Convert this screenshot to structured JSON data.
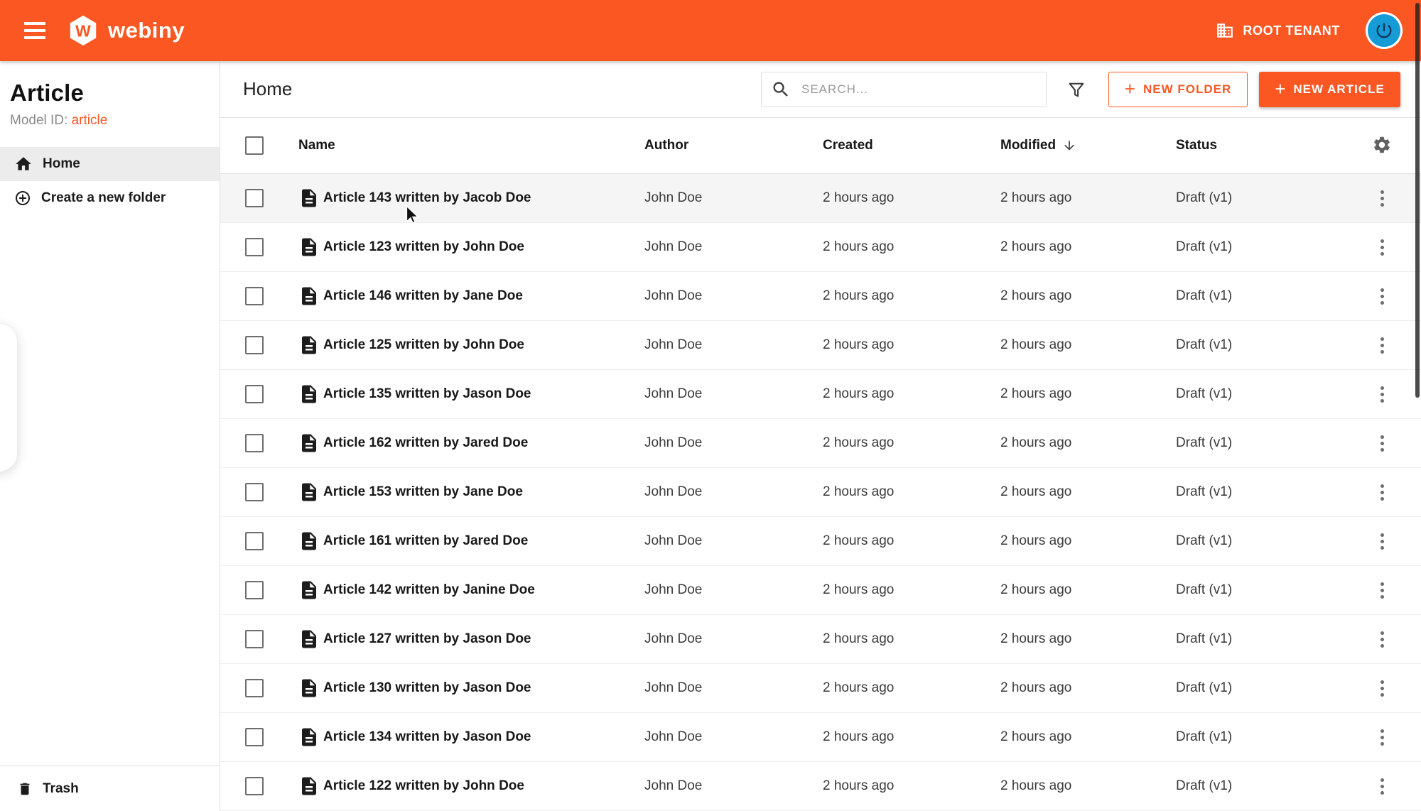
{
  "colors": {
    "accent": "#fa5723",
    "avatar": "#169bd7"
  },
  "topbar": {
    "brand_text": "webiny",
    "logo_letter": "W",
    "tenant_label": "ROOT TENANT"
  },
  "sidebar": {
    "title": "Article",
    "model_id_label": "Model ID:",
    "model_id_value": "article",
    "home_label": "Home",
    "create_folder_label": "Create a new folder",
    "trash_label": "Trash"
  },
  "main": {
    "breadcrumb": "Home",
    "search_placeholder": "SEARCH...",
    "plus_glyph": "+",
    "new_folder_label": "NEW FOLDER",
    "new_article_label": "NEW ARTICLE"
  },
  "table": {
    "headers": {
      "name": "Name",
      "author": "Author",
      "created": "Created",
      "modified": "Modified",
      "status": "Status"
    },
    "sort_column": "Modified",
    "sort_direction": "descending",
    "hovered_row_index": 0,
    "rows": [
      {
        "name": "Article 143 written by Jacob Doe",
        "author": "John Doe",
        "created": "2 hours ago",
        "modified": "2 hours ago",
        "status": "Draft (v1)"
      },
      {
        "name": "Article 123 written by John Doe",
        "author": "John Doe",
        "created": "2 hours ago",
        "modified": "2 hours ago",
        "status": "Draft (v1)"
      },
      {
        "name": "Article 146 written by Jane Doe",
        "author": "John Doe",
        "created": "2 hours ago",
        "modified": "2 hours ago",
        "status": "Draft (v1)"
      },
      {
        "name": "Article 125 written by John Doe",
        "author": "John Doe",
        "created": "2 hours ago",
        "modified": "2 hours ago",
        "status": "Draft (v1)"
      },
      {
        "name": "Article 135 written by Jason Doe",
        "author": "John Doe",
        "created": "2 hours ago",
        "modified": "2 hours ago",
        "status": "Draft (v1)"
      },
      {
        "name": "Article 162 written by Jared Doe",
        "author": "John Doe",
        "created": "2 hours ago",
        "modified": "2 hours ago",
        "status": "Draft (v1)"
      },
      {
        "name": "Article 153 written by Jane Doe",
        "author": "John Doe",
        "created": "2 hours ago",
        "modified": "2 hours ago",
        "status": "Draft (v1)"
      },
      {
        "name": "Article 161 written by Jared Doe",
        "author": "John Doe",
        "created": "2 hours ago",
        "modified": "2 hours ago",
        "status": "Draft (v1)"
      },
      {
        "name": "Article 142 written by Janine Doe",
        "author": "John Doe",
        "created": "2 hours ago",
        "modified": "2 hours ago",
        "status": "Draft (v1)"
      },
      {
        "name": "Article 127 written by Jason Doe",
        "author": "John Doe",
        "created": "2 hours ago",
        "modified": "2 hours ago",
        "status": "Draft (v1)"
      },
      {
        "name": "Article 130 written by Jason Doe",
        "author": "John Doe",
        "created": "2 hours ago",
        "modified": "2 hours ago",
        "status": "Draft (v1)"
      },
      {
        "name": "Article 134 written by Jason Doe",
        "author": "John Doe",
        "created": "2 hours ago",
        "modified": "2 hours ago",
        "status": "Draft (v1)"
      },
      {
        "name": "Article 122 written by John Doe",
        "author": "John Doe",
        "created": "2 hours ago",
        "modified": "2 hours ago",
        "status": "Draft (v1)"
      }
    ]
  }
}
